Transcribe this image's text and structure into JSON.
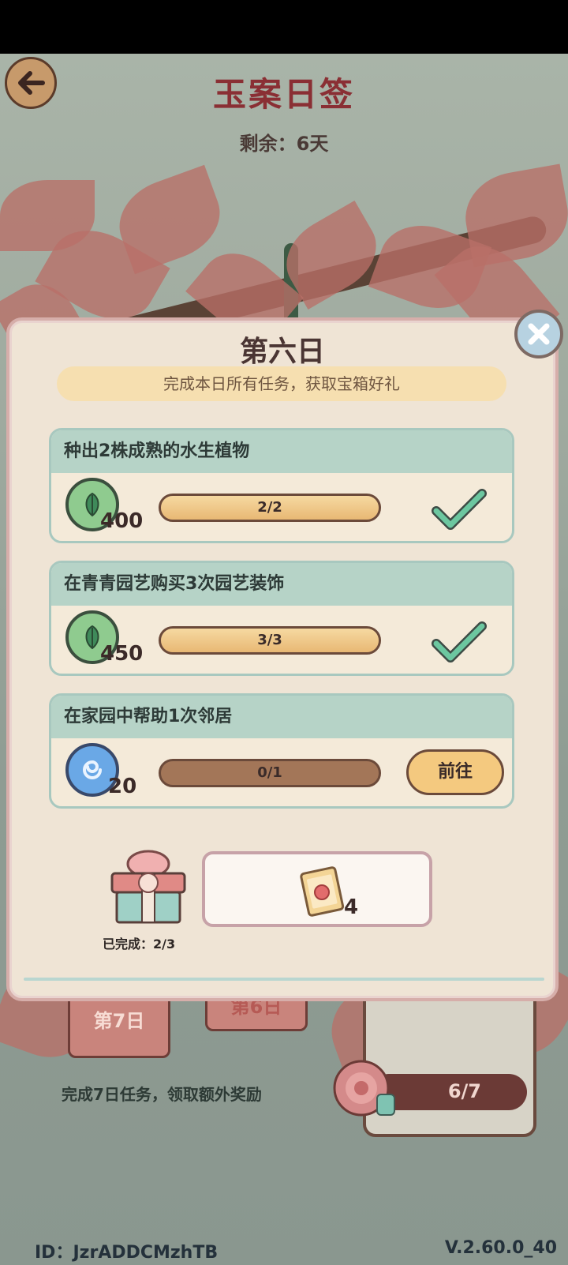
{
  "header": {
    "title": "玉案日签",
    "remaining_label": "剩余：6天"
  },
  "dialog": {
    "title": "第六日",
    "subtitle": "完成本日所有任务，获取宝箱好礼",
    "tasks": [
      {
        "title": "种出2株成熟的水生植物",
        "reward_icon": "leaf-coin-icon",
        "reward_qty": "400",
        "progress_text": "2/2",
        "progress": 1.0,
        "status": "completed"
      },
      {
        "title": "在青青园艺购买3次园艺装饰",
        "reward_icon": "leaf-coin-icon",
        "reward_qty": "450",
        "progress_text": "3/3",
        "progress": 1.0,
        "status": "completed"
      },
      {
        "title": "在家园中帮助1次邻居",
        "reward_icon": "swirl-coin-icon",
        "reward_qty": "20",
        "progress_text": "0/1",
        "progress": 0.0,
        "status": "go",
        "go_label": "前往"
      }
    ],
    "chest": {
      "completed_label": "已完成：2/3"
    },
    "chest_reward": {
      "icon": "scroll-icon",
      "qty": "4"
    }
  },
  "background": {
    "day7_label": "第7日",
    "day6_label": "第6日",
    "bonus_hint": "完成7日任务，领取额外奖励",
    "bonus_progress": "6/7"
  },
  "footer": {
    "id_label": "ID：JzrADDCMzhTB",
    "version": "V.2.60.0_40"
  },
  "colors": {
    "title": "#8a2f34",
    "dialog_bg": "#efe4d5",
    "task_header": "#b6d3c7",
    "bar_fill": "#e8b874",
    "check": "#6cc7a0"
  }
}
